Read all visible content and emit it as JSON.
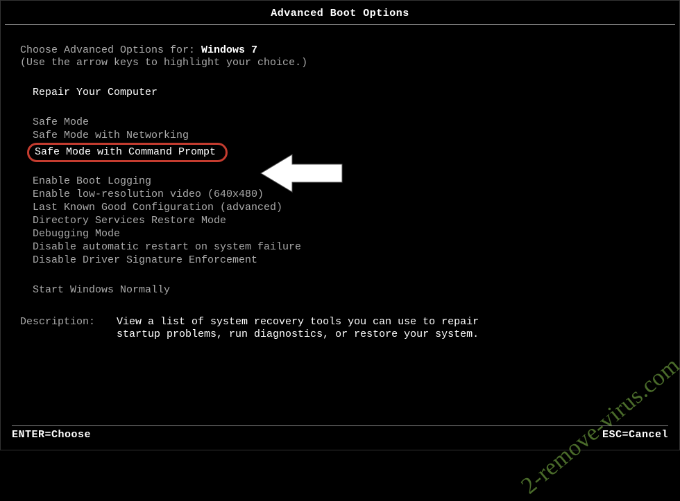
{
  "title": "Advanced Boot Options",
  "choose_prefix": "Choose Advanced Options for: ",
  "os_name": "Windows 7",
  "instruction": "(Use the arrow keys to highlight your choice.)",
  "groups": {
    "repair": "Repair Your Computer",
    "safe1": "Safe Mode",
    "safe2": "Safe Mode with Networking",
    "safe3": "Safe Mode with Command Prompt",
    "adv1": "Enable Boot Logging",
    "adv2": "Enable low-resolution video (640x480)",
    "adv3": "Last Known Good Configuration (advanced)",
    "adv4": "Directory Services Restore Mode",
    "adv5": "Debugging Mode",
    "adv6": "Disable automatic restart on system failure",
    "adv7": "Disable Driver Signature Enforcement",
    "normal": "Start Windows Normally"
  },
  "description_label": "Description:",
  "description_text": "View a list of system recovery tools you can use to repair startup problems, run diagnostics, or restore your system.",
  "footer": {
    "enter": "ENTER=Choose",
    "esc": "ESC=Cancel"
  },
  "watermark": "2-remove-virus.com"
}
